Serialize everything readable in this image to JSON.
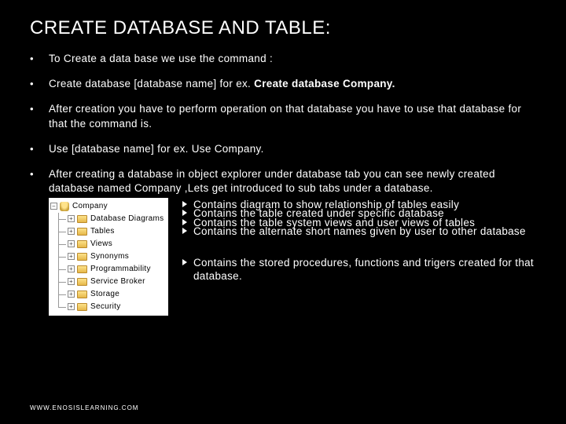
{
  "title": "CREATE DATABASE AND TABLE:",
  "bullets": {
    "b1": "To Create a data base we use the command :",
    "b2a": "Create database [database name]  for ex. ",
    "b2b": "Create database Company.",
    "b3": "After creation you have to perform operation on that database you have to use that database for that the command is.",
    "b4": "Use [database name] for ex. Use Company.",
    "b5": "After creating a database in object explorer under database tab you can see newly created database named Company ,Lets get introduced to sub tabs under a database."
  },
  "tree": {
    "root": "Company",
    "items": [
      "Database Diagrams",
      "Tables",
      "Views",
      "Synonyms",
      "Programmability",
      "Service Broker",
      "Storage",
      "Security"
    ]
  },
  "desc": {
    "d1": "Contains diagram to show relationship of tables easily",
    "d2": "Contains the table created under specific database",
    "d3": "Contains the table system views and user views of tables",
    "d4": "Contains the alternate short names given by user to other database",
    "d5": "Contains the stored procedures, functions and trigers created for that database."
  },
  "footer": "WWW.ENOSISLEARNING.COM"
}
